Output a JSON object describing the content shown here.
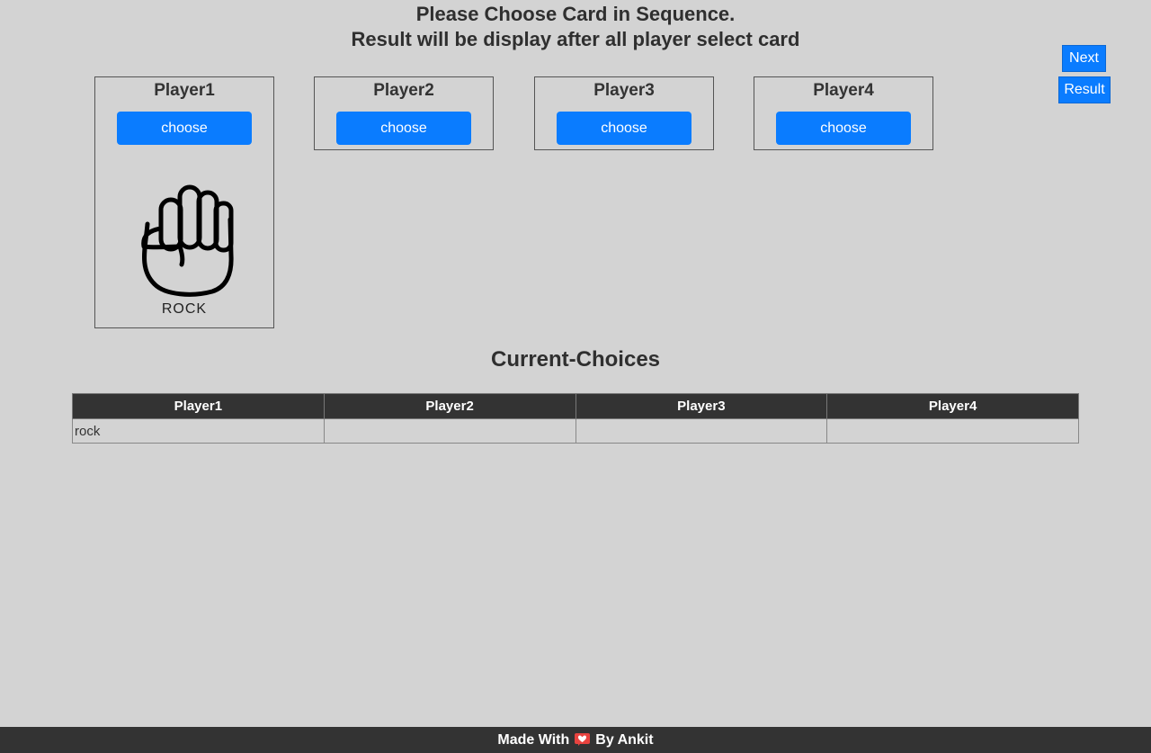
{
  "header": {
    "line1": "Please Choose Card in Sequence.",
    "line2": "Result will be display after all player select card"
  },
  "controls": {
    "next_label": "Next",
    "result_label": "Result"
  },
  "players": [
    {
      "name": "Player1",
      "button_label": "choose",
      "card_label": "ROCK",
      "card_icon": "rock-fist-icon"
    },
    {
      "name": "Player2",
      "button_label": "choose"
    },
    {
      "name": "Player3",
      "button_label": "choose"
    },
    {
      "name": "Player4",
      "button_label": "choose"
    }
  ],
  "choices": {
    "title": "Current-Choices",
    "headers": [
      "Player1",
      "Player2",
      "Player3",
      "Player4"
    ],
    "row": [
      "rock",
      "",
      "",
      ""
    ]
  },
  "footer": {
    "made_with": "Made With",
    "by": "By Ankit",
    "icon": "heart-icon"
  },
  "colors": {
    "background": "#d3d3d3",
    "accent": "#0a7cff",
    "dark": "#333333"
  }
}
